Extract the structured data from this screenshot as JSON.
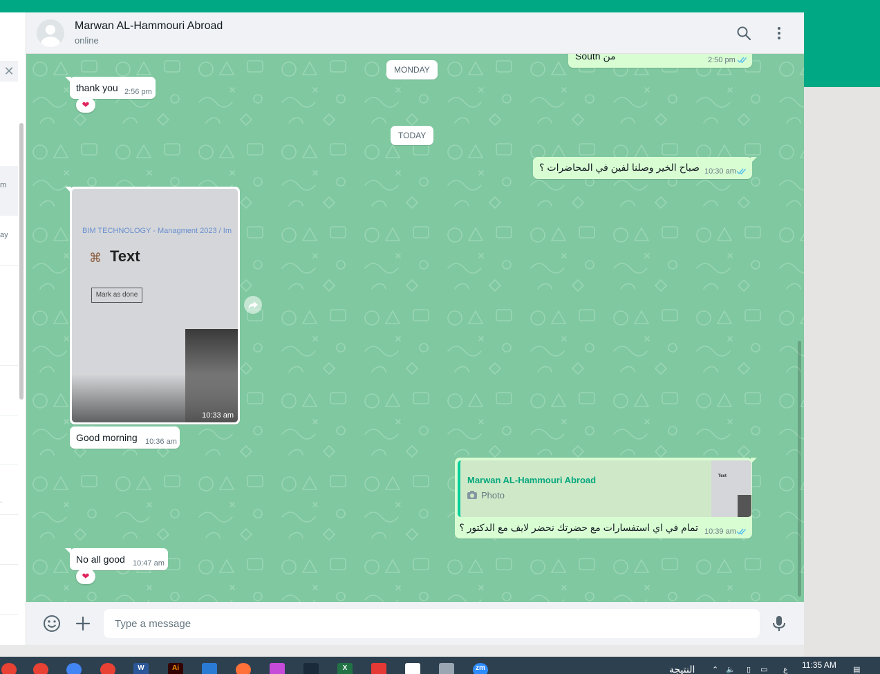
{
  "header": {
    "contact_name": "Marwan AL-Hammouri Abroad",
    "status": "online"
  },
  "left_panel": {
    "close_icon": "✕",
    "fragment_1": "m",
    "fragment_2": "ay",
    "fragment_3": "."
  },
  "date_dividers": {
    "monday": "MONDAY",
    "today": "TODAY"
  },
  "messages": [
    {
      "direction": "out",
      "text": "South من",
      "time": "2:50 pm",
      "ticks": "read"
    },
    {
      "direction": "in",
      "text": "thank you",
      "time": "2:56 pm",
      "reaction": "heart"
    },
    {
      "direction": "out",
      "text": "صباح الخير وصلنا لفين في المحاضرات ؟",
      "time": "10:30 am",
      "ticks": "read"
    },
    {
      "direction": "in",
      "type": "photo",
      "time": "10:33 am",
      "photo_content": {
        "breadcrumb": "BIM TECHNOLOGY - Managment 2023 / Im",
        "title": "Text",
        "button": "Mark as done"
      }
    },
    {
      "direction": "in",
      "text": "Good morning",
      "time": "10:36 am"
    },
    {
      "direction": "out",
      "text": "تمام في اي استفسارات مع حضرتك نحضر لايف مع الدكتور ؟",
      "time": "10:39 am",
      "ticks": "read",
      "quote": {
        "author": "Marwan AL-Hammouri Abroad",
        "label": "Photo",
        "thumb_title": "Text"
      }
    },
    {
      "direction": "in",
      "text": "No all good",
      "time": "10:47 am",
      "reaction": "heart"
    }
  ],
  "composer": {
    "placeholder": "Type a message"
  },
  "taskbar": {
    "clock": "11:35 AM",
    "weather": "النتيجة",
    "lang": "ع",
    "apps": [
      "W",
      "Ai",
      "X",
      "zm"
    ]
  },
  "colors": {
    "brand": "#00a884",
    "wallpaper": "#7fc8a0",
    "outgoing_bubble": "#d9fdd3",
    "incoming_bubble": "#ffffff",
    "read_ticks": "#53bdeb",
    "heart": "#e0245e"
  },
  "icons": {
    "search": "search-icon",
    "menu": "vertical-dots-icon",
    "emoji": "emoji-icon",
    "attach": "plus-icon",
    "mic": "microphone-icon",
    "forward": "forward-icon",
    "camera": "camera-icon",
    "reaction": "heart-icon"
  }
}
